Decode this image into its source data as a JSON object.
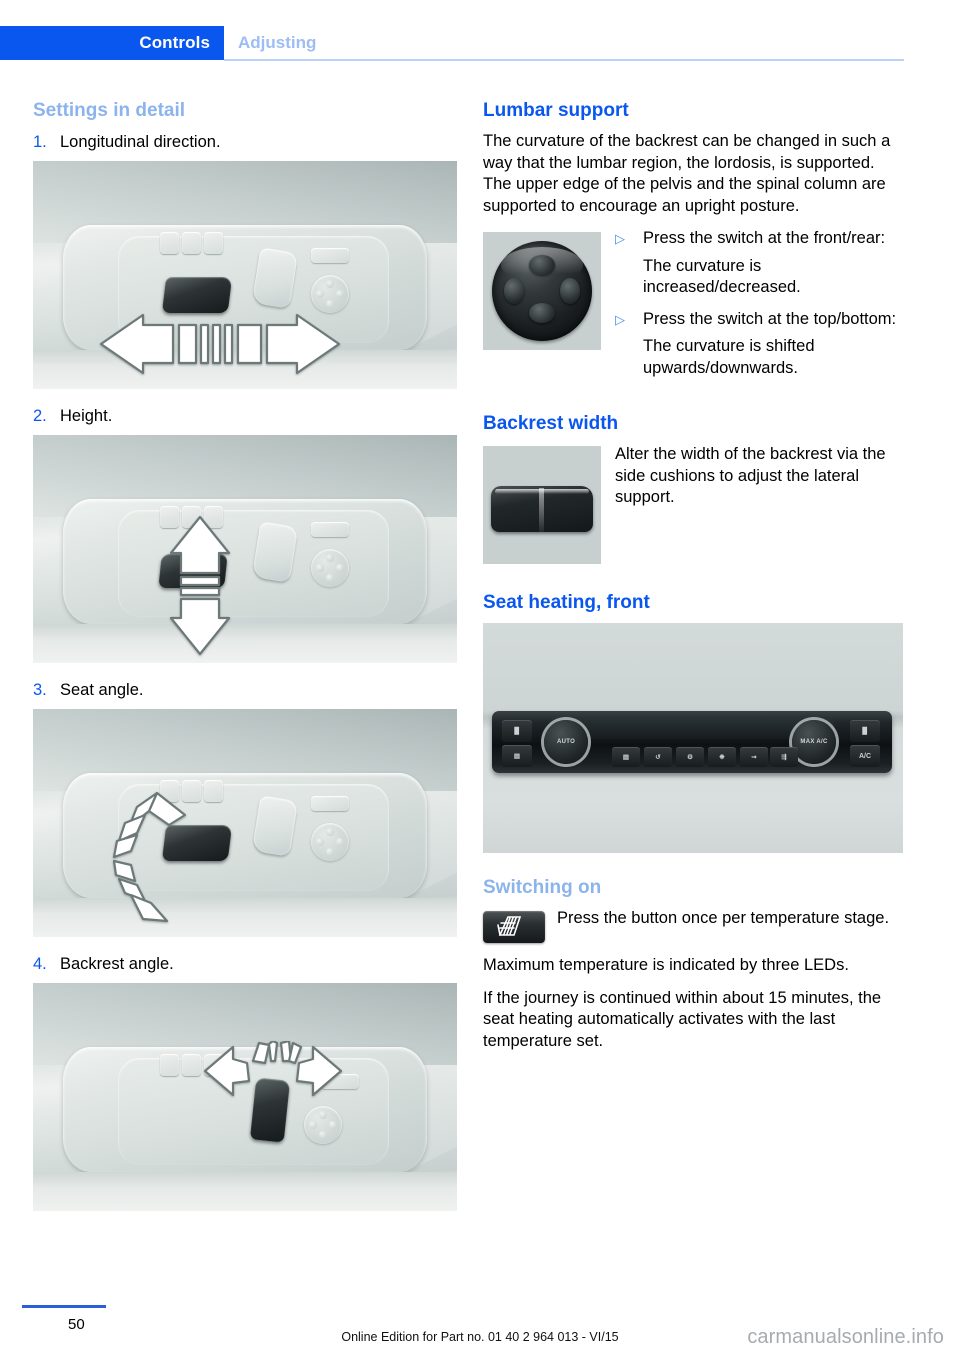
{
  "header": {
    "tab_label": "Controls",
    "section_label": "Adjusting",
    "accent_color": "#0a57ef",
    "pale_accent_color": "#9dbdf5"
  },
  "left_column": {
    "heading": "Settings in detail",
    "items": [
      {
        "number": "1.",
        "label": "Longitudinal direction.",
        "figure": "seat-console-longitudinal"
      },
      {
        "number": "2.",
        "label": "Height.",
        "figure": "seat-console-height"
      },
      {
        "number": "3.",
        "label": "Seat angle.",
        "figure": "seat-console-seat-angle"
      },
      {
        "number": "4.",
        "label": "Backrest angle.",
        "figure": "seat-console-backrest-angle"
      }
    ]
  },
  "right_column": {
    "lumbar": {
      "heading": "Lumbar support",
      "intro": "The curvature of the backrest can be changed in such a way that the lumbar region, the lordosis, is supported. The upper edge of the pelvis and the spinal column are supported to encourage an upright posture.",
      "figure_name": "lumbar-support-switch",
      "bullets": [
        {
          "marker": "▷",
          "text": "Press the switch at the front/rear:",
          "result": "The curvature is increased/decreased."
        },
        {
          "marker": "▷",
          "text": "Press the switch at the top/bottom:",
          "result": "The curvature is shifted upwards/downwards."
        }
      ]
    },
    "backrest_width": {
      "heading": "Backrest width",
      "figure_name": "backrest-width-switch",
      "text": "Alter the width of the backrest via the side cushions to adjust the lateral support."
    },
    "seat_heating": {
      "heading": "Seat heating, front",
      "figure_name": "climate-control-panel",
      "panel": {
        "left_knob_label": "AUTO",
        "right_knob_label": "MAX A/C",
        "buttons": [
          "seat-heating-icon",
          "rear-window-defroster-icon",
          "windshield-defroster-icon",
          "air-recirculation-icon",
          "auto-air-recirculation-icon",
          "fan-icon",
          "air-distribution-face-icon",
          "air-distribution-feet-icon",
          "passenger-seat-heating-icon",
          "A/C"
        ]
      }
    },
    "switching_on": {
      "heading": "Switching on",
      "button_icon": "seat-heating-button-icon",
      "button_text": "Press the button once per temperature stage.",
      "paragraphs": [
        "Maximum temperature is indicated by three LEDs.",
        "If the journey is continued within about 15 minutes, the seat heating automatically activates with the last temperature set."
      ]
    }
  },
  "footer": {
    "page_number": "50",
    "edition_text": "Online Edition for Part no. 01 40 2 964 013 - VI/15",
    "watermark": "carmanualsonline.info"
  }
}
